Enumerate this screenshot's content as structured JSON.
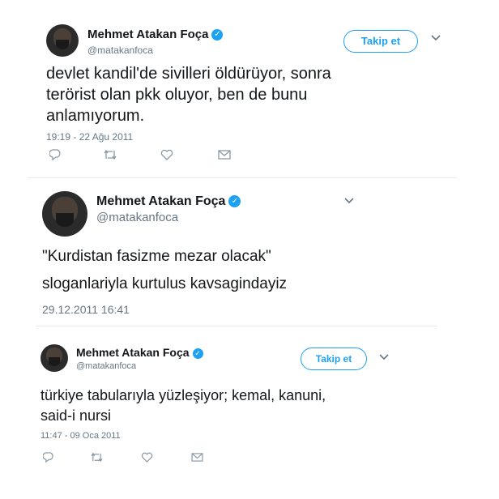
{
  "tweets": [
    {
      "name": "Mehmet Atakan Foça",
      "handle": "@matakanfoca",
      "follow_label": "Takip et",
      "lines": [
        "devlet kandil'de sivilleri öldürüyor, sonra",
        "terörist olan pkk oluyor, ben de bunu",
        "anlamıyorum."
      ],
      "timestamp": "19:19 - 22 Ağu 2011"
    },
    {
      "name": "Mehmet Atakan Foça",
      "handle": "@matakanfoca",
      "lines": [
        "\"Kurdistan fasizme mezar olacak\"",
        "sloganlariyla kurtulus kavsagindayiz"
      ],
      "timestamp": "29.12.2011 16:41"
    },
    {
      "name": "Mehmet Atakan Foça",
      "handle": "@matakanfoca",
      "follow_label": "Takip et",
      "lines": [
        "türkiye tabularıyla yüzleşiyor; kemal, kanuni,",
        "said-i nursi"
      ],
      "timestamp": "11:47 - 09 Oca 2011"
    }
  ],
  "icons": {
    "verified": "verified-badge-icon",
    "chevron": "chevron-down-icon",
    "reply": "reply-icon",
    "retweet": "retweet-icon",
    "like": "heart-icon",
    "message": "envelope-icon"
  },
  "colors": {
    "accent": "#1da1f2",
    "muted": "#657786"
  }
}
